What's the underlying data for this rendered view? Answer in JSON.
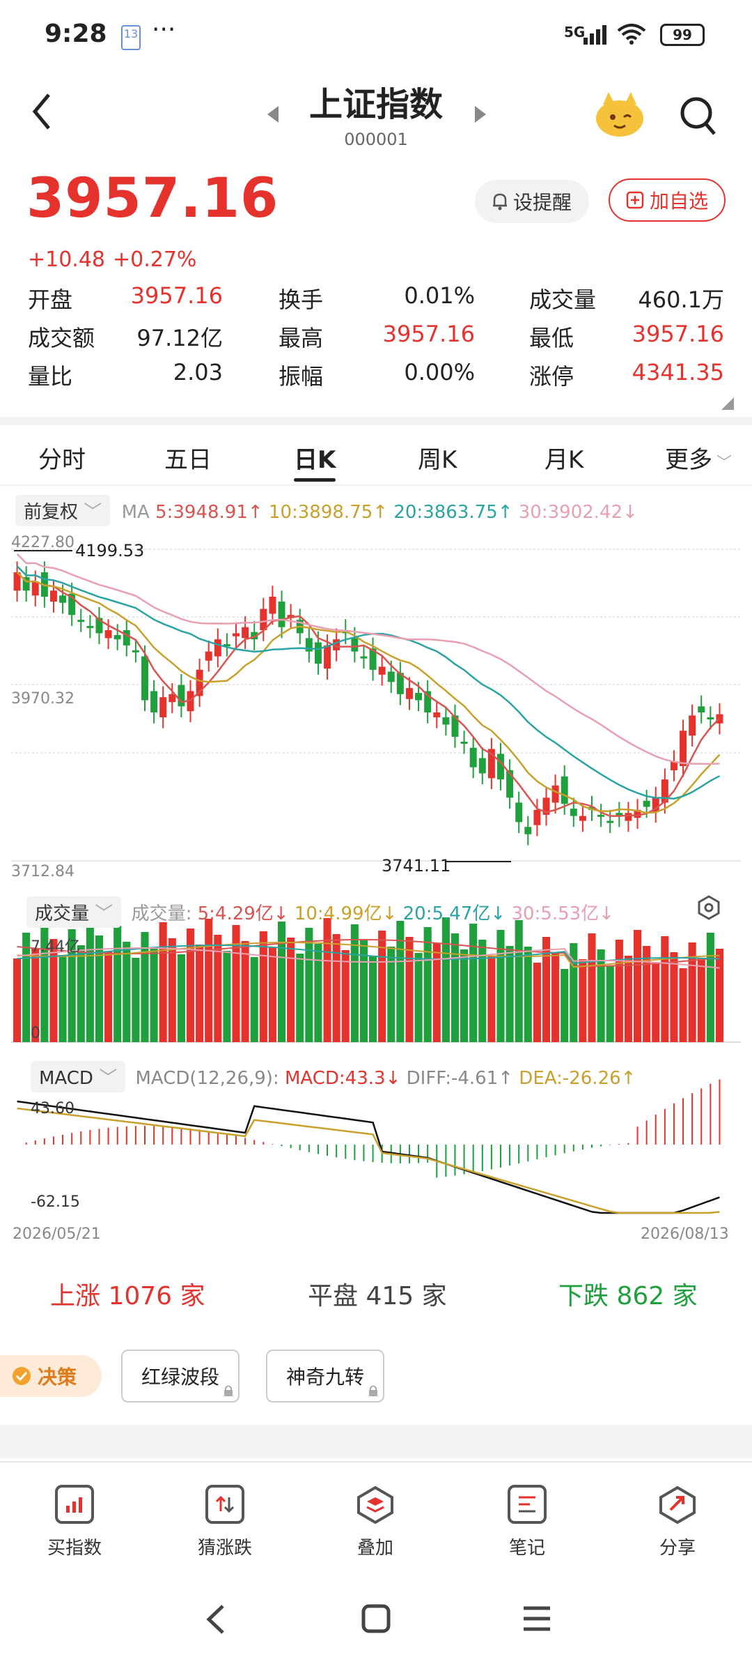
{
  "status_bar": {
    "time": "9:28",
    "notif_badge": "13",
    "dots": "···",
    "network": "5G",
    "battery": "99"
  },
  "header": {
    "title": "上证指数",
    "code": "000001"
  },
  "quote": {
    "price": "3957.16",
    "change": "+10.48",
    "change_pct": "+0.27%",
    "alert_label": "设提醒",
    "watch_label": "加自选"
  },
  "stats": [
    [
      {
        "k": "开盘",
        "v": "3957.16",
        "c": "red"
      },
      {
        "k": "换手",
        "v": "0.01%",
        "c": "dark"
      },
      {
        "k": "成交量",
        "v": "460.1万",
        "c": "dark"
      }
    ],
    [
      {
        "k": "成交额",
        "v": "97.12亿",
        "c": "dark"
      },
      {
        "k": "最高",
        "v": "3957.16",
        "c": "red"
      },
      {
        "k": "最低",
        "v": "3957.16",
        "c": "red"
      }
    ],
    [
      {
        "k": "量比",
        "v": "2.03",
        "c": "dark"
      },
      {
        "k": "振幅",
        "v": "0.00%",
        "c": "dark"
      },
      {
        "k": "涨停",
        "v": "4341.35",
        "c": "red"
      }
    ]
  ],
  "tabs": {
    "t1": "分时",
    "t2": "五日",
    "t3": "日K",
    "t4": "周K",
    "t5": "月K",
    "t6": "更多"
  },
  "kline": {
    "adjust": "前复权",
    "ma_label": "MA",
    "ma5": "5:3948.91↑",
    "ma10": "10:3898.75↑",
    "ma20": "20:3863.75↑",
    "ma30": "30:3902.42↓",
    "y_top": "4227.80",
    "y_mid": "3970.32",
    "y_bot": "3712.84",
    "high_mark": "4199.53",
    "low_mark": "3741.11"
  },
  "volume": {
    "dropdown": "成交量",
    "label": "成交量:",
    "ma5": "5:4.29亿↓",
    "ma10": "10:4.99亿↓",
    "ma20": "20:5.47亿↓",
    "ma30": "30:5.53亿↓",
    "y_top": "7.44亿",
    "y_zero": "0"
  },
  "macd": {
    "dropdown": "MACD",
    "params": "MACD(12,26,9):",
    "macd": "MACD:43.3↓",
    "diff": "DIFF:-4.61↑",
    "dea": "DEA:-26.26↑",
    "y_top": "43.60",
    "y_bot": "-62.15",
    "date_start": "2026/05/21",
    "date_end": "2026/08/13"
  },
  "breadth": {
    "up": "上涨 1076 家",
    "flat": "平盘 415 家",
    "down": "下跌 862 家"
  },
  "tools": {
    "decision": "决策",
    "t1": "红绿波段",
    "t2": "神奇九转"
  },
  "bottom_nav": {
    "n1": "买指数",
    "n2": "猜涨跌",
    "n3": "叠加",
    "n4": "笔记",
    "n5": "分享"
  },
  "colors": {
    "up": "#e5322d",
    "down": "#1fa03c",
    "ma5": "#d9534f",
    "ma10": "#c8a02b",
    "ma20": "#2aa3a3",
    "ma30": "#e8a0b0"
  }
}
